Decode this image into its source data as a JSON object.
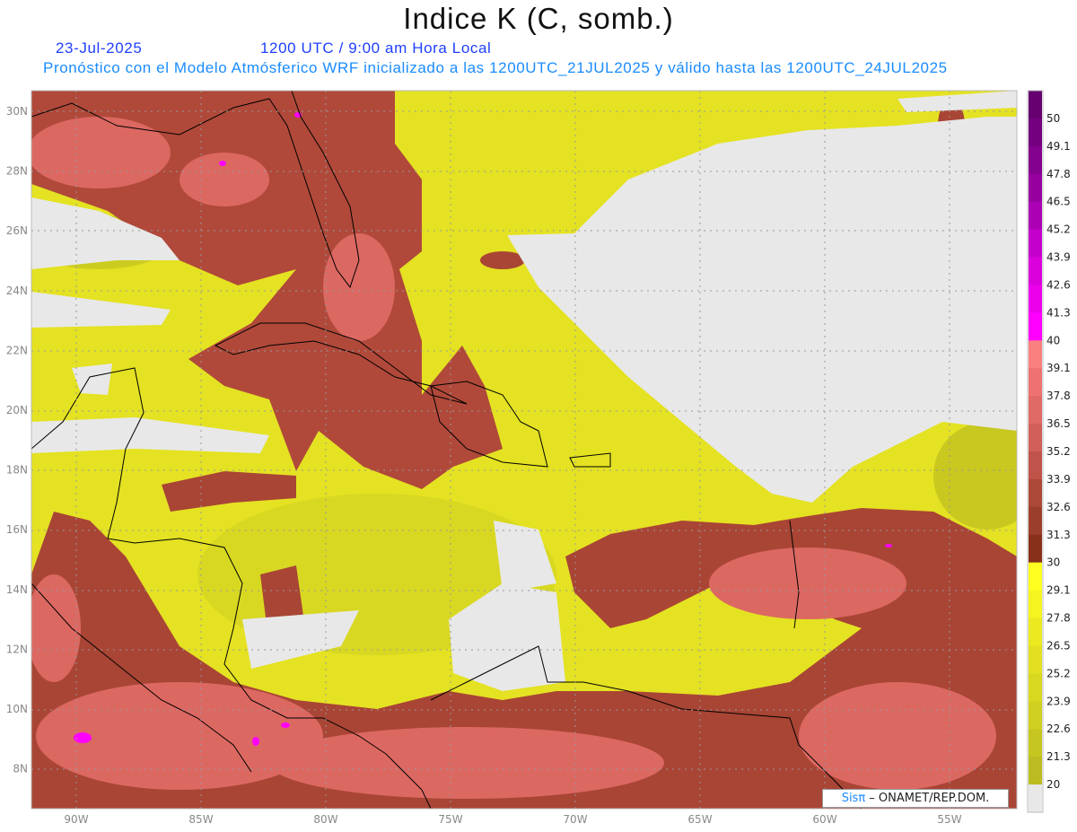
{
  "header": {
    "title": "Indice K (C, somb.)",
    "date": "23-Jul-2025",
    "time": "1200 UTC / 9:00 am Hora Local",
    "description": "Pronóstico con el Modelo Atmósferico WRF inicializado a las 1200UTC_21JUL2025 y válido hasta las  1200UTC_24JUL2025"
  },
  "axes": {
    "longitude_labels": [
      "90W",
      "85W",
      "80W",
      "75W",
      "70W",
      "65W",
      "60W",
      "55W"
    ],
    "latitude_labels": [
      "30N",
      "28N",
      "26N",
      "24N",
      "22N",
      "20N",
      "18N",
      "16N",
      "14N",
      "12N",
      "10N",
      "8N"
    ]
  },
  "colorbar": {
    "labels": [
      "50",
      "49.1",
      "47.8",
      "46.5",
      "45.2",
      "43.9",
      "42.6",
      "41.3",
      "40",
      "39.1",
      "37.8",
      "36.5",
      "35.2",
      "33.9",
      "32.6",
      "31.3",
      "30",
      "29.1",
      "27.8",
      "26.5",
      "25.2",
      "23.9",
      "22.6",
      "21.3",
      "20"
    ],
    "colors": [
      "#660070",
      "#740080",
      "#84008e",
      "#96009e",
      "#ac00b4",
      "#c400cc",
      "#da00dc",
      "#ec00ec",
      "#ff00ff",
      "#fa8080",
      "#ee7272",
      "#e06a66",
      "#d06058",
      "#c0544a",
      "#ac4838",
      "#9c3e2c",
      "#88301a",
      "#ffff20",
      "#f5f420",
      "#ebe920",
      "#e2e020",
      "#d8d820",
      "#d0d020",
      "#c6c620",
      "#bcbc20",
      "#e8e8e8"
    ]
  },
  "credit": {
    "brand": "Sisπ",
    "text": " – ONAMET/REP.DOM."
  }
}
